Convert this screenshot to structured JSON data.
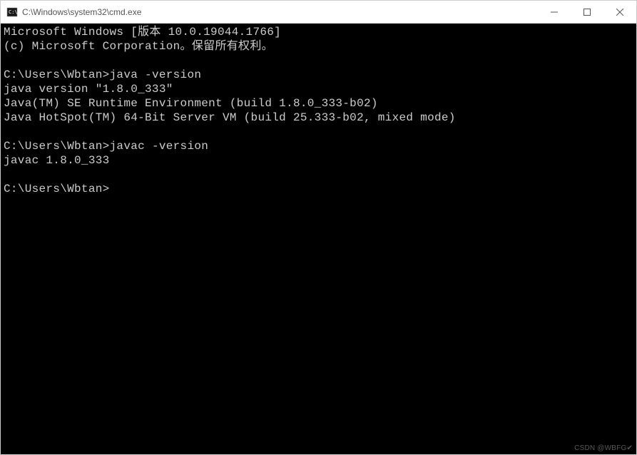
{
  "titlebar": {
    "title": "C:\\Windows\\system32\\cmd.exe"
  },
  "terminal": {
    "line1": "Microsoft Windows [版本 10.0.19044.1766]",
    "line2": "(c) Microsoft Corporation。保留所有权利。",
    "blank1": "",
    "prompt1_path": "C:\\Users\\Wbtan>",
    "prompt1_cmd": "java -version",
    "out1": "java version \"1.8.0_333\"",
    "out2": "Java(TM) SE Runtime Environment (build 1.8.0_333-b02)",
    "out3": "Java HotSpot(TM) 64-Bit Server VM (build 25.333-b02, mixed mode)",
    "blank2": "",
    "prompt2_path": "C:\\Users\\Wbtan>",
    "prompt2_cmd": "javac -version",
    "out4": "javac 1.8.0_333",
    "blank3": "",
    "prompt3_path": "C:\\Users\\Wbtan>"
  },
  "watermark": "CSDN @WBFG✔"
}
